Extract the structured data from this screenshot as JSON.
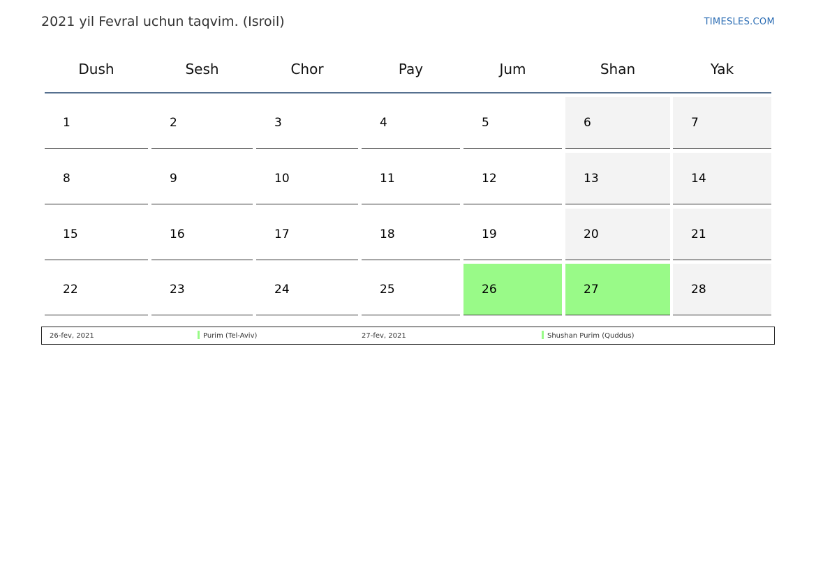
{
  "header": {
    "title": "2021 yil Fevral uchun taqvim. (Isroil)",
    "site": "TIMESLES.COM"
  },
  "weekdays": [
    "Dush",
    "Sesh",
    "Chor",
    "Pay",
    "Jum",
    "Shan",
    "Yak"
  ],
  "weeks": [
    [
      {
        "day": "1",
        "type": "normal"
      },
      {
        "day": "2",
        "type": "normal"
      },
      {
        "day": "3",
        "type": "normal"
      },
      {
        "day": "4",
        "type": "normal"
      },
      {
        "day": "5",
        "type": "normal"
      },
      {
        "day": "6",
        "type": "weekend"
      },
      {
        "day": "7",
        "type": "weekend"
      }
    ],
    [
      {
        "day": "8",
        "type": "normal"
      },
      {
        "day": "9",
        "type": "normal"
      },
      {
        "day": "10",
        "type": "normal"
      },
      {
        "day": "11",
        "type": "normal"
      },
      {
        "day": "12",
        "type": "normal"
      },
      {
        "day": "13",
        "type": "weekend"
      },
      {
        "day": "14",
        "type": "weekend"
      }
    ],
    [
      {
        "day": "15",
        "type": "normal"
      },
      {
        "day": "16",
        "type": "normal"
      },
      {
        "day": "17",
        "type": "normal"
      },
      {
        "day": "18",
        "type": "normal"
      },
      {
        "day": "19",
        "type": "normal"
      },
      {
        "day": "20",
        "type": "weekend"
      },
      {
        "day": "21",
        "type": "weekend"
      }
    ],
    [
      {
        "day": "22",
        "type": "normal"
      },
      {
        "day": "23",
        "type": "normal"
      },
      {
        "day": "24",
        "type": "normal"
      },
      {
        "day": "25",
        "type": "normal"
      },
      {
        "day": "26",
        "type": "holiday"
      },
      {
        "day": "27",
        "type": "holiday"
      },
      {
        "day": "28",
        "type": "weekend"
      }
    ]
  ],
  "legend": [
    {
      "date": "26-fev, 2021",
      "name": "Purim (Tel-Aviv)"
    },
    {
      "date": "27-fev, 2021",
      "name": "Shushan Purim (Quddus)"
    }
  ],
  "colors": {
    "holiday": "#99fa88",
    "weekend": "#f3f3f3",
    "accent": "#56708f",
    "link": "#2c6db4"
  }
}
